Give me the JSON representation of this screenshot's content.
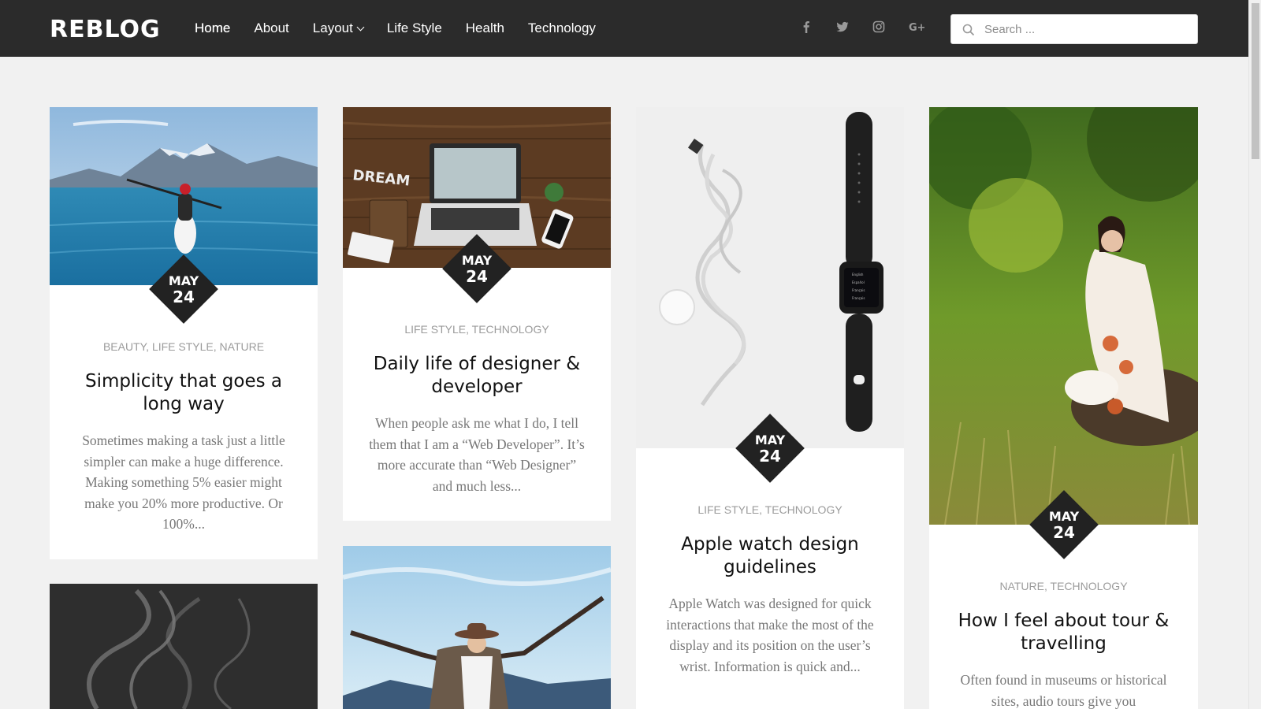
{
  "brand": {
    "logo": "REBLOG"
  },
  "nav": {
    "items": [
      {
        "label": "Home"
      },
      {
        "label": "About"
      },
      {
        "label": "Layout"
      },
      {
        "label": "Life Style"
      },
      {
        "label": "Health"
      },
      {
        "label": "Technology"
      }
    ]
  },
  "social": {
    "icons": [
      "facebook-icon",
      "twitter-icon",
      "instagram-icon",
      "google-plus-icon"
    ]
  },
  "search": {
    "placeholder": "Search ...",
    "value": ""
  },
  "posts": [
    {
      "date": {
        "month": "MAY",
        "day": "24"
      },
      "categories": [
        "BEAUTY",
        "LIFE STYLE",
        "NATURE"
      ],
      "title": "Simplicity that goes a long way",
      "excerpt": "Sometimes making a task just a little simpler can make a huge difference. Making something 5% easier might make you 20% more productive. Or 100%..."
    },
    {
      "date": {
        "month": "MAY",
        "day": "24"
      },
      "categories": [
        "LIFE STYLE",
        "TECHNOLOGY"
      ],
      "title": "Daily life of designer & developer",
      "excerpt": "When people ask me what I do, I tell them that I am a “Web Developer”. It’s more accurate than “Web Designer” and much less..."
    },
    {
      "date": {
        "month": "MAY",
        "day": "24"
      },
      "categories": [
        "LIFE STYLE",
        "TECHNOLOGY"
      ],
      "title": "Apple watch design guidelines",
      "excerpt": "Apple Watch was designed for quick interactions that make the most of the display and its position on the user’s wrist. Information is quick and..."
    },
    {
      "date": {
        "month": "MAY",
        "day": "24"
      },
      "categories": [
        "NATURE",
        "TECHNOLOGY"
      ],
      "title": "How I feel about tour & travelling",
      "excerpt": "Often found in museums or historical sites, audio tours give you"
    }
  ],
  "colors": {
    "header": "#2b2b2b",
    "page": "#f1f1f1",
    "date_badge": "#222222",
    "muted_text": "#9b9b9b"
  }
}
